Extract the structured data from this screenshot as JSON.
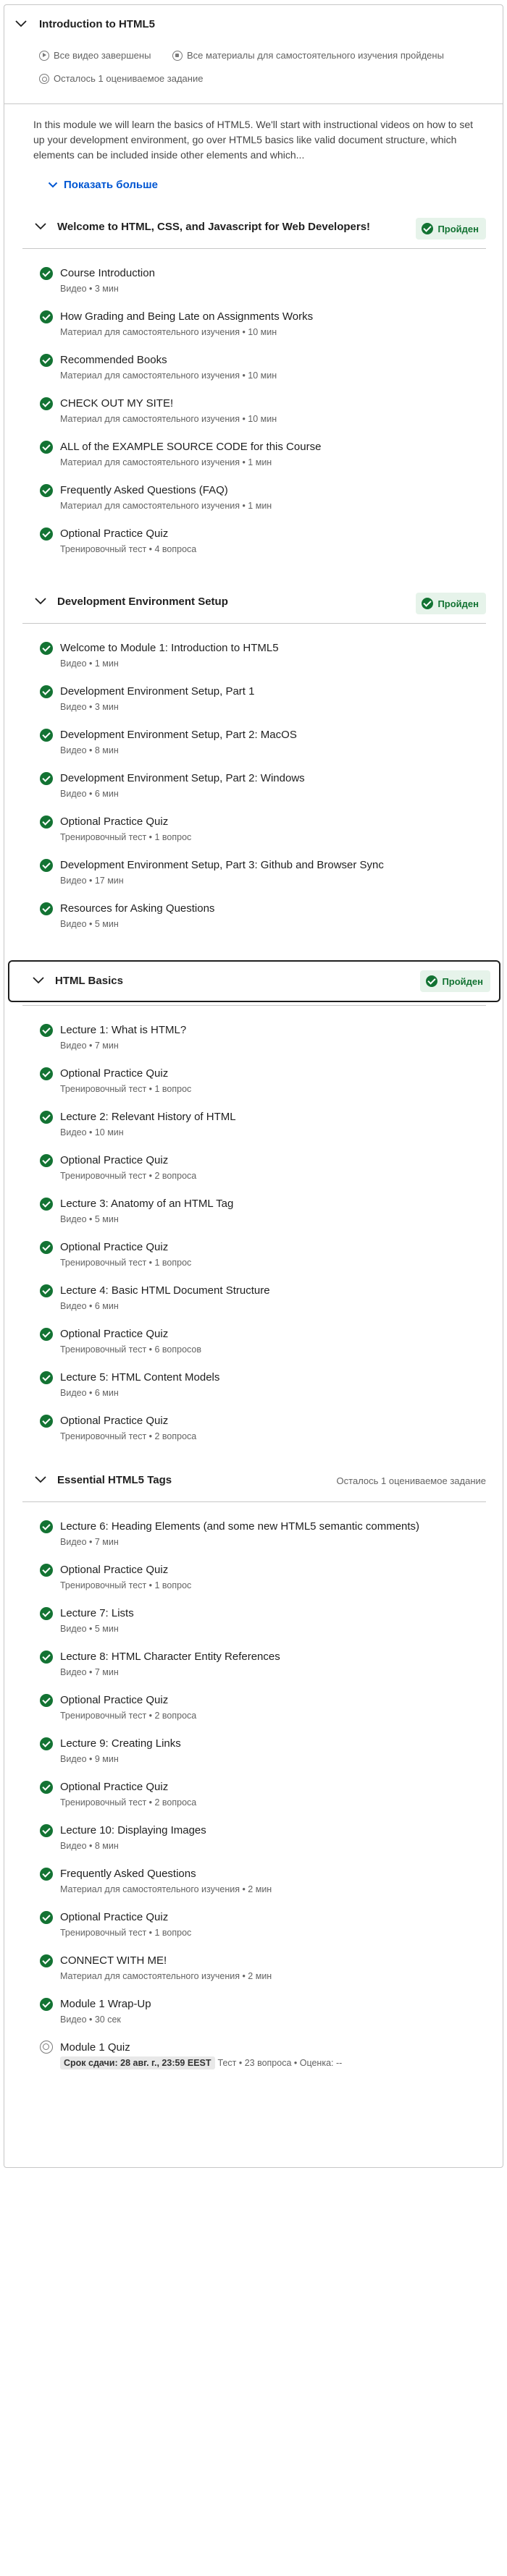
{
  "module": {
    "title": "Introduction to HTML5",
    "meta": [
      {
        "icon": "play-circle-icon",
        "text": "Все видео завершены"
      },
      {
        "icon": "document-icon",
        "text": "Все материалы для самостоятельного изучения пройдены"
      },
      {
        "icon": "quiz-icon",
        "text": "Осталось 1 оцениваемое задание"
      }
    ],
    "description": "In this module we will learn the basics of HTML5. We'll start with instructional videos on how to set up your development environment, go over HTML5 basics like valid document structure, which elements can be included inside other elements and which...",
    "show_more": "Показать больше"
  },
  "sections": [
    {
      "title": "Welcome to HTML, CSS, and Javascript for Web Developers!",
      "badge": "Пройден",
      "items": [
        {
          "title": "Course Introduction",
          "meta": "Видео • 3 мин",
          "done": true
        },
        {
          "title": "How Grading and Being Late on Assignments Works",
          "meta": "Материал для самостоятельного изучения • 10 мин",
          "done": true
        },
        {
          "title": "Recommended Books",
          "meta": "Материал для самостоятельного изучения • 10 мин",
          "done": true
        },
        {
          "title": "CHECK OUT MY SITE!",
          "meta": "Материал для самостоятельного изучения • 10 мин",
          "done": true
        },
        {
          "title": "ALL of the EXAMPLE SOURCE CODE for this Course",
          "meta": "Материал для самостоятельного изучения • 1 мин",
          "done": true
        },
        {
          "title": "Frequently Asked Questions (FAQ)",
          "meta": "Материал для самостоятельного изучения • 1 мин",
          "done": true
        },
        {
          "title": "Optional Practice Quiz",
          "meta": "Тренировочный тест • 4 вопроса",
          "done": true
        }
      ]
    },
    {
      "title": "Development Environment Setup",
      "badge": "Пройден",
      "items": [
        {
          "title": "Welcome to Module 1: Introduction to HTML5",
          "meta": "Видео • 1 мин",
          "done": true
        },
        {
          "title": "Development Environment Setup, Part 1",
          "meta": "Видео • 3 мин",
          "done": true
        },
        {
          "title": "Development Environment Setup, Part 2: MacOS",
          "meta": "Видео • 8 мин",
          "done": true
        },
        {
          "title": "Development Environment Setup, Part 2: Windows",
          "meta": "Видео • 6 мин",
          "done": true
        },
        {
          "title": "Optional Practice Quiz",
          "meta": "Тренировочный тест • 1 вопрос",
          "done": true
        },
        {
          "title": "Development Environment Setup, Part 3: Github and Browser Sync",
          "meta": "Видео • 17 мин",
          "done": true
        },
        {
          "title": "Resources for Asking Questions",
          "meta": "Видео • 5 мин",
          "done": true
        }
      ]
    },
    {
      "title": "HTML Basics",
      "badge": "Пройден",
      "items": [
        {
          "title": "Lecture 1: What is HTML?",
          "meta": "Видео • 7 мин",
          "done": true
        },
        {
          "title": "Optional Practice Quiz",
          "meta": "Тренировочный тест • 1 вопрос",
          "done": true
        },
        {
          "title": "Lecture 2: Relevant History of HTML",
          "meta": "Видео • 10 мин",
          "done": true
        },
        {
          "title": "Optional Practice Quiz",
          "meta": "Тренировочный тест • 2 вопроса",
          "done": true
        },
        {
          "title": "Lecture 3: Anatomy of an HTML Tag",
          "meta": "Видео • 5 мин",
          "done": true
        },
        {
          "title": "Optional Practice Quiz",
          "meta": "Тренировочный тест • 1 вопрос",
          "done": true
        },
        {
          "title": "Lecture 4: Basic HTML Document Structure",
          "meta": "Видео • 6 мин",
          "done": true
        },
        {
          "title": "Optional Practice Quiz",
          "meta": "Тренировочный тест • 6 вопросов",
          "done": true
        },
        {
          "title": "Lecture 5: HTML Content Models",
          "meta": "Видео • 6 мин",
          "done": true
        },
        {
          "title": "Optional Practice Quiz",
          "meta": "Тренировочный тест • 2 вопроса",
          "done": true
        }
      ]
    },
    {
      "title": "Essential HTML5 Tags",
      "note": "Осталось 1 оцениваемое задание",
      "items": [
        {
          "title": "Lecture 6: Heading Elements (and some new HTML5 semantic comments)",
          "meta": "Видео • 7 мин",
          "done": true
        },
        {
          "title": "Optional Practice Quiz",
          "meta": "Тренировочный тест • 1 вопрос",
          "done": true
        },
        {
          "title": "Lecture 7: Lists",
          "meta": "Видео • 5 мин",
          "done": true
        },
        {
          "title": "Lecture 8: HTML Character Entity References",
          "meta": "Видео • 7 мин",
          "done": true
        },
        {
          "title": "Optional Practice Quiz",
          "meta": "Тренировочный тест • 2 вопроса",
          "done": true
        },
        {
          "title": "Lecture 9: Creating Links",
          "meta": "Видео • 9 мин",
          "done": true
        },
        {
          "title": "Optional Practice Quiz",
          "meta": "Тренировочный тест • 2 вопроса",
          "done": true
        },
        {
          "title": "Lecture 10: Displaying Images",
          "meta": "Видео • 8 мин",
          "done": true
        },
        {
          "title": "Frequently Asked Questions",
          "meta": "Материал для самостоятельного изучения • 2 мин",
          "done": true
        },
        {
          "title": "Optional Practice Quiz",
          "meta": "Тренировочный тест • 1 вопрос",
          "done": true
        },
        {
          "title": "CONNECT WITH ME!",
          "meta": "Материал для самостоятельного изучения • 2 мин",
          "done": true
        },
        {
          "title": "Module 1 Wrap-Up",
          "meta": "Видео • 30 сек",
          "done": true
        },
        {
          "title": "Module 1 Quiz",
          "due": "Срок сдачи: 28 авг. г., 23:59 EEST",
          "meta": "Тест • 23 вопроса • Оценка: --",
          "done": false
        }
      ]
    }
  ]
}
